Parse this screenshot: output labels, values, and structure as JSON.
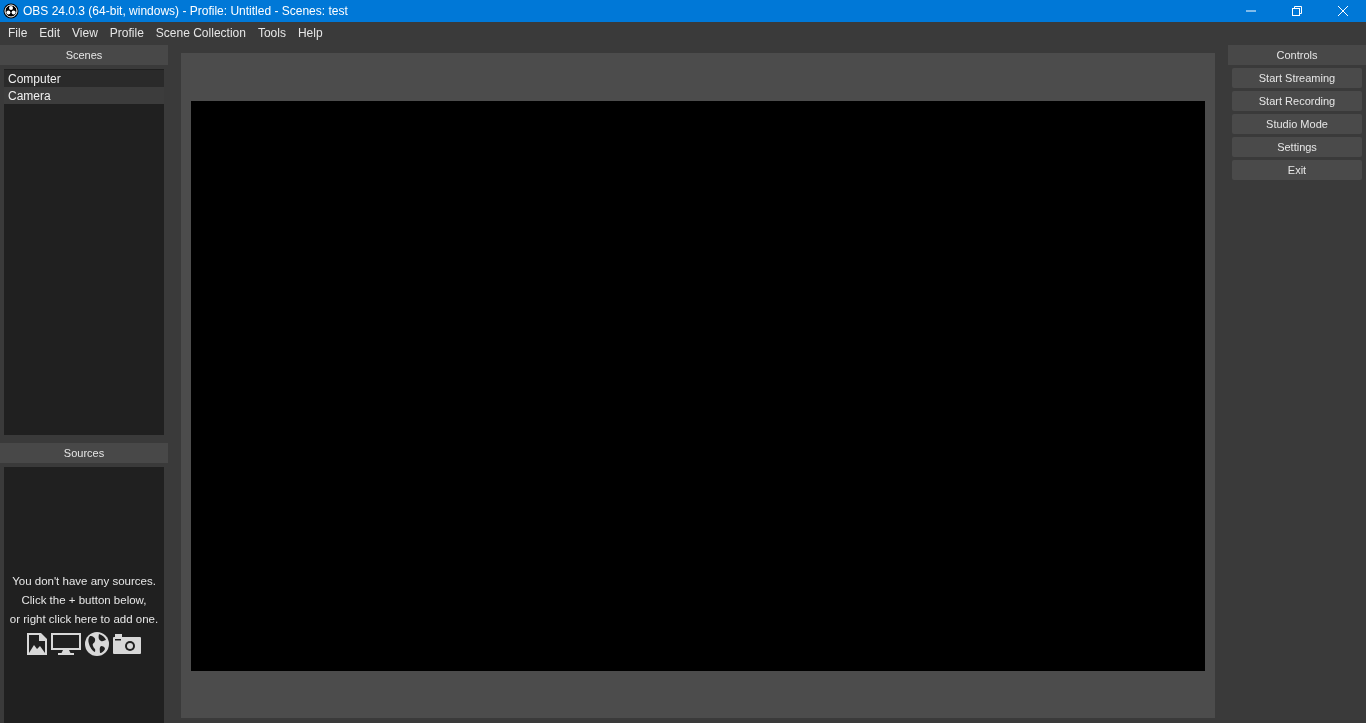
{
  "window": {
    "title": "OBS 24.0.3 (64-bit, windows) - Profile: Untitled - Scenes: test"
  },
  "menu": [
    "File",
    "Edit",
    "View",
    "Profile",
    "Scene Collection",
    "Tools",
    "Help"
  ],
  "scenes": {
    "title": "Scenes",
    "items": [
      {
        "label": "Computer",
        "selected": false
      },
      {
        "label": "Camera",
        "selected": true
      }
    ]
  },
  "sources": {
    "title": "Sources",
    "empty_message": [
      "You don't have any sources.",
      "Click the + button below,",
      "or right click here to add one."
    ]
  },
  "controls": {
    "title": "Controls",
    "buttons": [
      "Start Streaming",
      "Start Recording",
      "Studio Mode",
      "Settings",
      "Exit"
    ]
  }
}
